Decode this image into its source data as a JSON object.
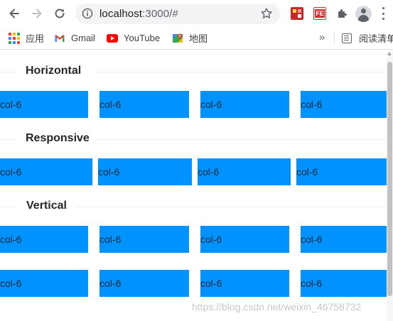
{
  "browser": {
    "url_host": "localhost",
    "url_rest": ":3000/#",
    "icons": [
      "back-arrow-icon",
      "forward-arrow-icon",
      "reload-icon",
      "info-icon",
      "star-icon",
      "extension-red-icon",
      "extension-fe-icon",
      "puzzle-icon",
      "profile-avatar-icon",
      "menu-dots-icon"
    ],
    "extension_fe_label": "FE"
  },
  "bookmarks": {
    "items": [
      {
        "label": "应用",
        "icon": "apps-grid-icon"
      },
      {
        "label": "Gmail",
        "icon": "gmail-icon"
      },
      {
        "label": "YouTube",
        "icon": "youtube-icon"
      },
      {
        "label": "地图",
        "icon": "maps-icon"
      }
    ],
    "overflow": "»",
    "reading_list": "阅读清单"
  },
  "sections": [
    {
      "title": "Horizontal",
      "rows": [
        [
          "col-6",
          "col-6",
          "col-6",
          "col-6"
        ]
      ]
    },
    {
      "title": "Responsive",
      "rows": [
        [
          "col-6",
          "col-6",
          "col-6",
          "col-6"
        ]
      ]
    },
    {
      "title": "Vertical",
      "rows": [
        [
          "col-6",
          "col-6",
          "col-6",
          "col-6"
        ],
        [
          "col-6",
          "col-6",
          "col-6",
          "col-6"
        ]
      ]
    }
  ],
  "colors": {
    "col_bg": "#0092ff",
    "divider_line": "#f0f0f0",
    "heading": "#262626"
  },
  "watermark": "https://blog.csdn.net/weixin_46758732"
}
